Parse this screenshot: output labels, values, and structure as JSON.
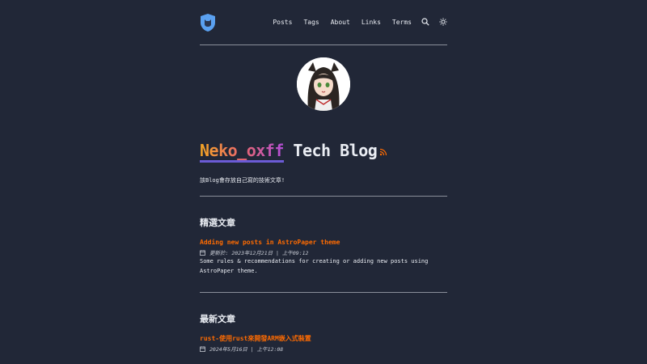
{
  "nav": {
    "items": [
      "Posts",
      "Tags",
      "About",
      "Links",
      "Terms"
    ]
  },
  "hero": {
    "title_highlight": "Neko_oxff",
    "title_rest": " Tech Blog",
    "description": "該Blog會存放自己寫的技術文章!"
  },
  "featured": {
    "heading": "精選文章",
    "posts": [
      {
        "title": "Adding new posts in AstroPaper theme",
        "meta": "更新於: 2023年12月21日 | 上午09:12",
        "description": "Some rules & recommendations for creating or adding new posts using AstroPaper theme."
      }
    ]
  },
  "recent": {
    "heading": "最新文章",
    "posts": [
      {
        "title": "rust-使用rust來開發ARM嵌入式裝置",
        "meta": "2024年5月16日 | 上午12:08"
      }
    ]
  },
  "colors": {
    "background": "#212737",
    "accent": "#ff6b01",
    "text": "#eaedf3"
  }
}
